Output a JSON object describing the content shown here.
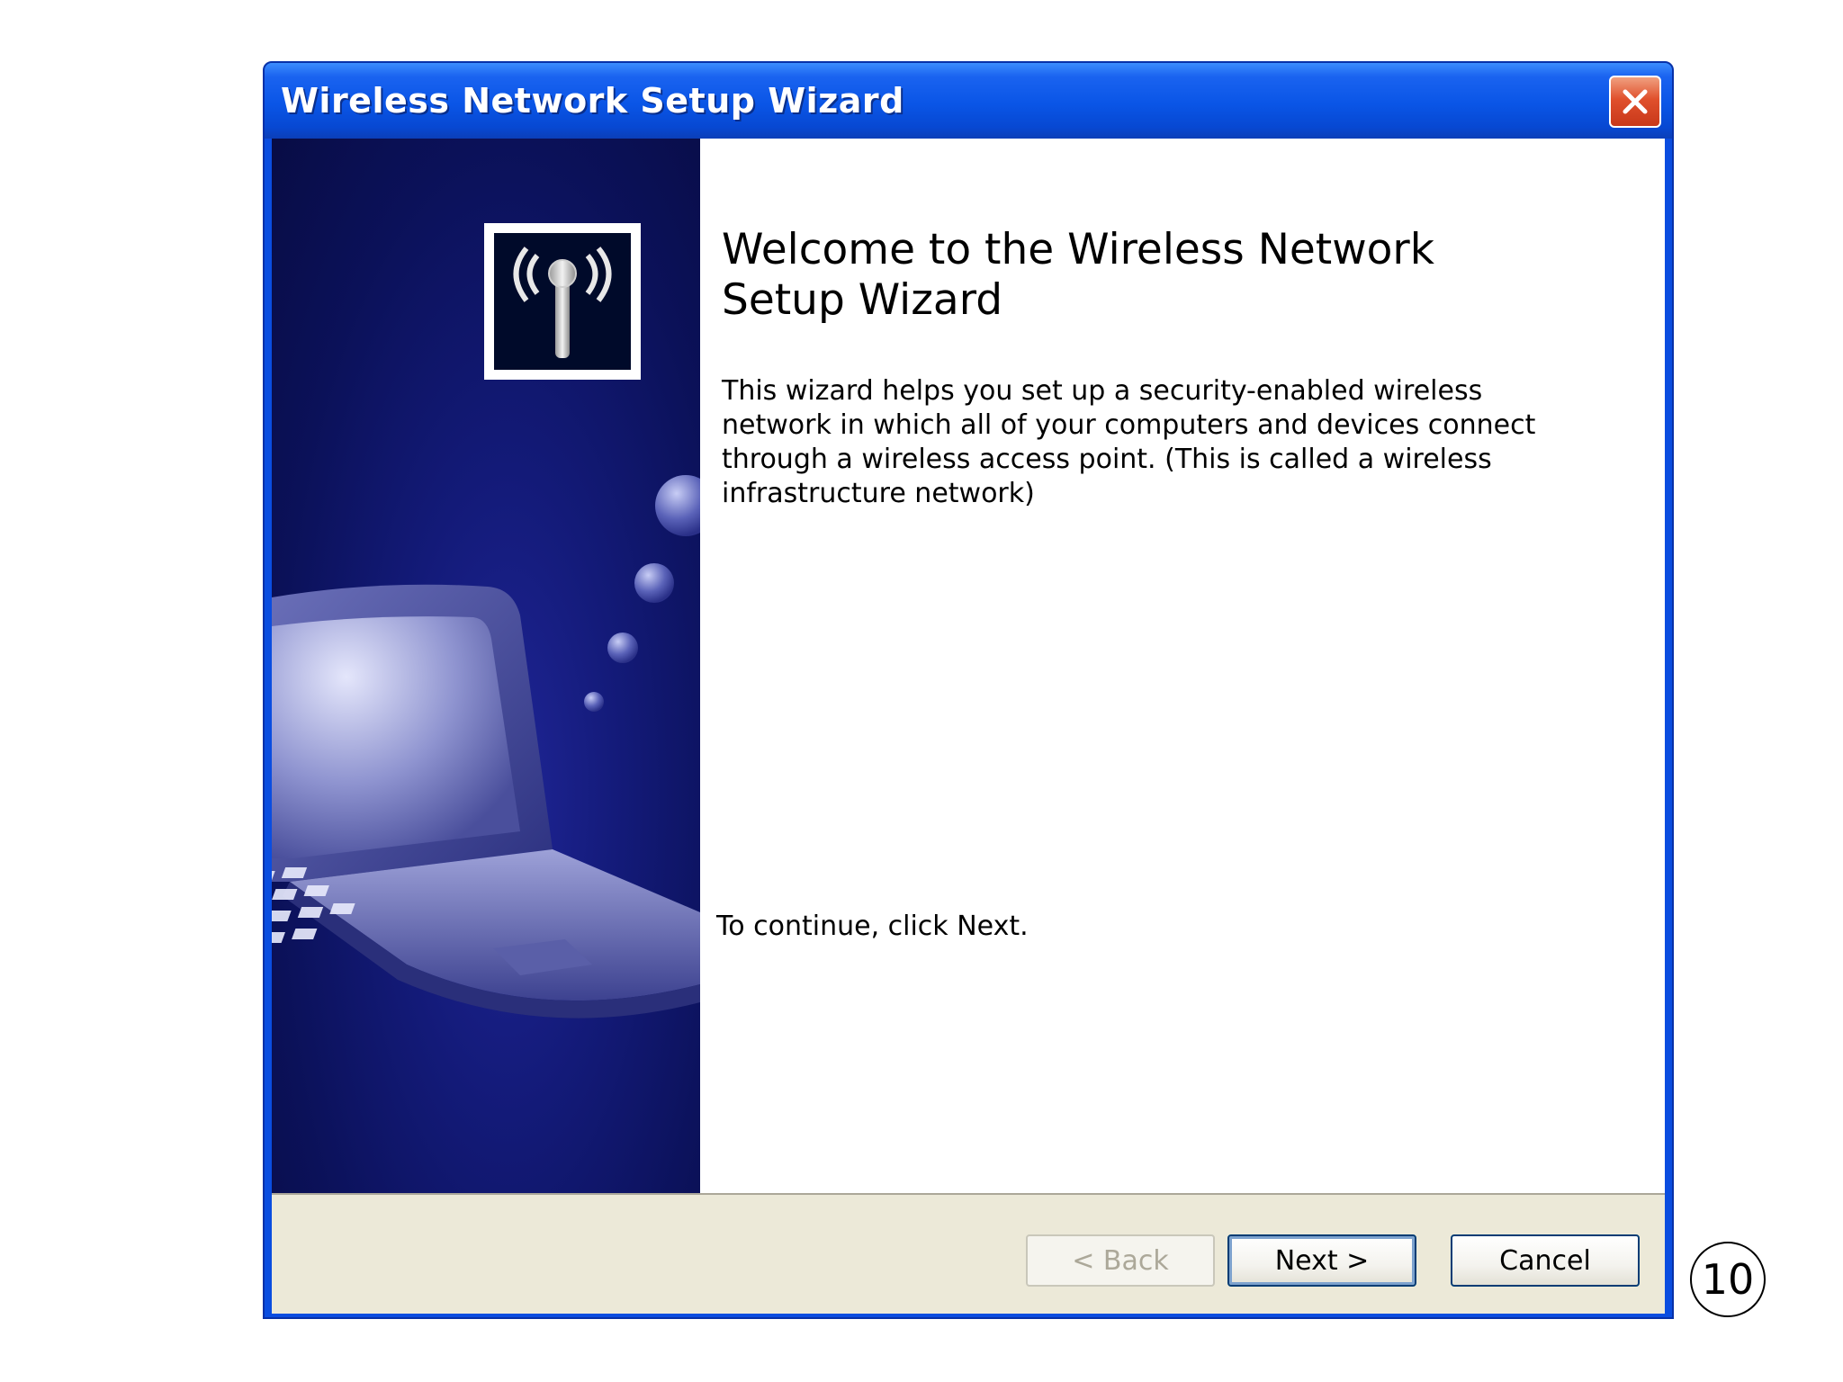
{
  "window": {
    "title": "Wireless Network Setup Wizard",
    "close_label": "×"
  },
  "wizard": {
    "heading_line1": "Welcome to the Wireless Network",
    "heading_line2": "Setup Wizard",
    "description": "This wizard helps you set up a security-enabled wireless network in which all of your computers and devices connect through a wireless access point. (This is called a wireless infrastructure network)",
    "continue_text": "To continue, click Next."
  },
  "buttons": {
    "back_label": "< Back",
    "next_label": "Next >",
    "cancel_label": "Cancel"
  },
  "callout": {
    "number": "10"
  },
  "colors": {
    "titlebar": "#0a55e6",
    "side_panel": "#0b1159",
    "footer": "#ece9d8",
    "close_button": "#e0502c"
  }
}
